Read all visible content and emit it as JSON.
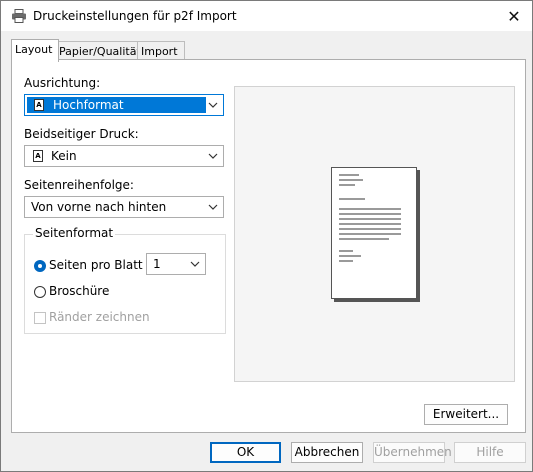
{
  "window": {
    "title": "Druckeinstellungen für p2f Import"
  },
  "tabs": [
    {
      "label": "Layout",
      "active": true
    },
    {
      "label": "Papier/Qualität",
      "active": false
    },
    {
      "label": "Import",
      "active": false
    }
  ],
  "layout": {
    "orientation": {
      "label": "Ausrichtung:",
      "value": "Hochformat",
      "icon": "portrait-page-icon"
    },
    "duplex": {
      "label": "Beidseitiger Druck:",
      "value": "Kein",
      "icon": "single-page-icon"
    },
    "page_order": {
      "label": "Seitenreihenfolge:",
      "value": "Von vorne nach hinten"
    },
    "page_format": {
      "title": "Seitenformat",
      "pages_per_sheet": {
        "label": "Seiten pro Blatt",
        "selected": true,
        "value": "1"
      },
      "booklet": {
        "label": "Broschüre",
        "selected": false
      },
      "draw_borders": {
        "label": "Ränder zeichnen",
        "checked": false,
        "enabled": false
      }
    },
    "advanced_button": "Erweitert..."
  },
  "buttons": {
    "ok": "OK",
    "cancel": "Abbrechen",
    "apply": "Übernehmen",
    "help": "Hilfe"
  },
  "colors": {
    "accent": "#0078d7",
    "window_bg": "#f0f0f0",
    "disabled_text": "#a0a0a0"
  }
}
